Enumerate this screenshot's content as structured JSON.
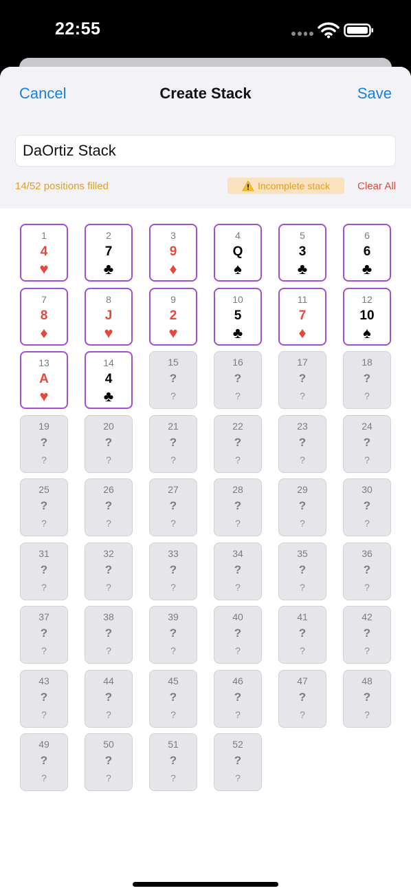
{
  "status_bar": {
    "time": "22:55"
  },
  "nav": {
    "cancel_label": "Cancel",
    "title": "Create Stack",
    "save_label": "Save"
  },
  "form": {
    "stack_name": "DaOrtiz Stack",
    "progress_text": "14/52 positions filled",
    "warning_text": "Incomplete stack",
    "clear_all_label": "Clear All"
  },
  "colors": {
    "accent_blue": "#1a7fe0",
    "warning_orange": "#e6a020",
    "destructive_red": "#e5483c",
    "card_border_purple": "#a24dd4"
  },
  "cards": [
    {
      "pos": "1",
      "rank": "4",
      "suit": "♥",
      "color": "red"
    },
    {
      "pos": "2",
      "rank": "7",
      "suit": "♣",
      "color": "black"
    },
    {
      "pos": "3",
      "rank": "9",
      "suit": "♦",
      "color": "red"
    },
    {
      "pos": "4",
      "rank": "Q",
      "suit": "♠",
      "color": "black"
    },
    {
      "pos": "5",
      "rank": "3",
      "suit": "♣",
      "color": "black"
    },
    {
      "pos": "6",
      "rank": "6",
      "suit": "♣",
      "color": "black"
    },
    {
      "pos": "7",
      "rank": "8",
      "suit": "♦",
      "color": "red"
    },
    {
      "pos": "8",
      "rank": "J",
      "suit": "♥",
      "color": "red"
    },
    {
      "pos": "9",
      "rank": "2",
      "suit": "♥",
      "color": "red"
    },
    {
      "pos": "10",
      "rank": "5",
      "suit": "♣",
      "color": "black"
    },
    {
      "pos": "11",
      "rank": "7",
      "suit": "♦",
      "color": "red"
    },
    {
      "pos": "12",
      "rank": "10",
      "suit": "♠",
      "color": "black"
    },
    {
      "pos": "13",
      "rank": "A",
      "suit": "♥",
      "color": "red"
    },
    {
      "pos": "14",
      "rank": "4",
      "suit": "♣",
      "color": "black"
    },
    {
      "pos": "15",
      "rank": "?",
      "suit": "?",
      "color": "empty"
    },
    {
      "pos": "16",
      "rank": "?",
      "suit": "?",
      "color": "empty"
    },
    {
      "pos": "17",
      "rank": "?",
      "suit": "?",
      "color": "empty"
    },
    {
      "pos": "18",
      "rank": "?",
      "suit": "?",
      "color": "empty"
    },
    {
      "pos": "19",
      "rank": "?",
      "suit": "?",
      "color": "empty"
    },
    {
      "pos": "20",
      "rank": "?",
      "suit": "?",
      "color": "empty"
    },
    {
      "pos": "21",
      "rank": "?",
      "suit": "?",
      "color": "empty"
    },
    {
      "pos": "22",
      "rank": "?",
      "suit": "?",
      "color": "empty"
    },
    {
      "pos": "23",
      "rank": "?",
      "suit": "?",
      "color": "empty"
    },
    {
      "pos": "24",
      "rank": "?",
      "suit": "?",
      "color": "empty"
    },
    {
      "pos": "25",
      "rank": "?",
      "suit": "?",
      "color": "empty"
    },
    {
      "pos": "26",
      "rank": "?",
      "suit": "?",
      "color": "empty"
    },
    {
      "pos": "27",
      "rank": "?",
      "suit": "?",
      "color": "empty"
    },
    {
      "pos": "28",
      "rank": "?",
      "suit": "?",
      "color": "empty"
    },
    {
      "pos": "29",
      "rank": "?",
      "suit": "?",
      "color": "empty"
    },
    {
      "pos": "30",
      "rank": "?",
      "suit": "?",
      "color": "empty"
    },
    {
      "pos": "31",
      "rank": "?",
      "suit": "?",
      "color": "empty"
    },
    {
      "pos": "32",
      "rank": "?",
      "suit": "?",
      "color": "empty"
    },
    {
      "pos": "33",
      "rank": "?",
      "suit": "?",
      "color": "empty"
    },
    {
      "pos": "34",
      "rank": "?",
      "suit": "?",
      "color": "empty"
    },
    {
      "pos": "35",
      "rank": "?",
      "suit": "?",
      "color": "empty"
    },
    {
      "pos": "36",
      "rank": "?",
      "suit": "?",
      "color": "empty"
    },
    {
      "pos": "37",
      "rank": "?",
      "suit": "?",
      "color": "empty"
    },
    {
      "pos": "38",
      "rank": "?",
      "suit": "?",
      "color": "empty"
    },
    {
      "pos": "39",
      "rank": "?",
      "suit": "?",
      "color": "empty"
    },
    {
      "pos": "40",
      "rank": "?",
      "suit": "?",
      "color": "empty"
    },
    {
      "pos": "41",
      "rank": "?",
      "suit": "?",
      "color": "empty"
    },
    {
      "pos": "42",
      "rank": "?",
      "suit": "?",
      "color": "empty"
    },
    {
      "pos": "43",
      "rank": "?",
      "suit": "?",
      "color": "empty"
    },
    {
      "pos": "44",
      "rank": "?",
      "suit": "?",
      "color": "empty"
    },
    {
      "pos": "45",
      "rank": "?",
      "suit": "?",
      "color": "empty"
    },
    {
      "pos": "46",
      "rank": "?",
      "suit": "?",
      "color": "empty"
    },
    {
      "pos": "47",
      "rank": "?",
      "suit": "?",
      "color": "empty"
    },
    {
      "pos": "48",
      "rank": "?",
      "suit": "?",
      "color": "empty"
    },
    {
      "pos": "49",
      "rank": "?",
      "suit": "?",
      "color": "empty"
    },
    {
      "pos": "50",
      "rank": "?",
      "suit": "?",
      "color": "empty"
    },
    {
      "pos": "51",
      "rank": "?",
      "suit": "?",
      "color": "empty"
    },
    {
      "pos": "52",
      "rank": "?",
      "suit": "?",
      "color": "empty"
    }
  ]
}
